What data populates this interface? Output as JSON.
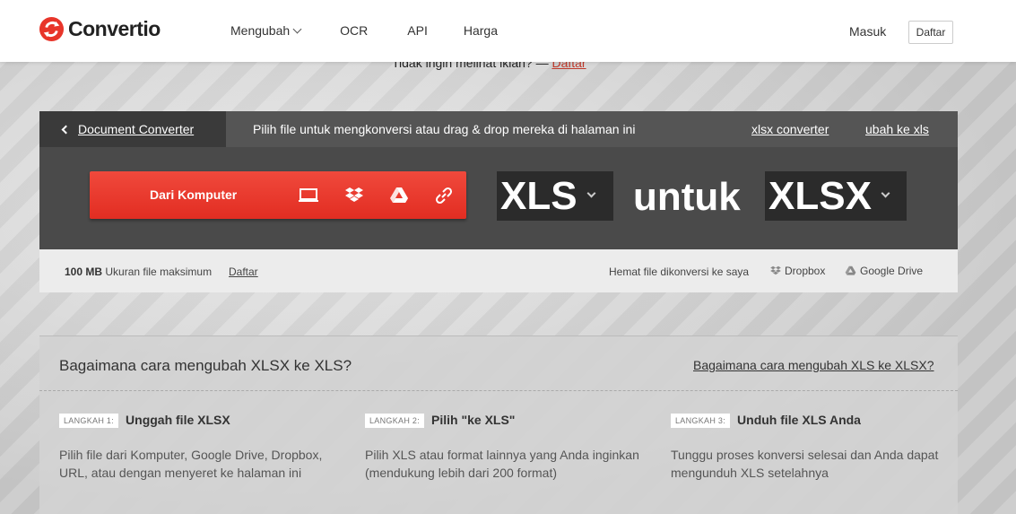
{
  "header": {
    "logo_text": "Convertio",
    "nav": [
      "Mengubah",
      "OCR",
      "API",
      "Harga"
    ],
    "login": "Masuk",
    "signup": "Daftar"
  },
  "ad": {
    "text": "Tidak ingin melihat iklan? —",
    "link": "Daftar"
  },
  "converter": {
    "back_label": "Document Converter",
    "hint": "Pilih file untuk mengkonversi atau drag & drop mereka di halaman ini",
    "link1": "xlsx converter",
    "link2": "ubah ke xls",
    "upload_label": "Dari Komputer",
    "from_format": "XLS",
    "to_word": "untuk",
    "to_format": "XLSX"
  },
  "info": {
    "size_bold": "100 MB",
    "size_text": "Ukuran file maksimum",
    "signup": "Daftar",
    "save_text": "Hemat file dikonversi ke saya",
    "dropbox": "Dropbox",
    "gdrive": "Google Drive"
  },
  "howto": {
    "title": "Bagaimana cara mengubah XLSX ke XLS?",
    "link": "Bagaimana cara mengubah XLS ke XLSX?",
    "steps": [
      {
        "badge": "LANGKAH 1:",
        "title": "Unggah file XLSX",
        "desc": "Pilih file dari Komputer, Google Drive, Dropbox, URL, atau dengan menyeret ke halaman ini"
      },
      {
        "badge": "LANGKAH 2:",
        "title": "Pilih \"ke XLS\"",
        "desc": "Pilih XLS atau format lainnya yang Anda inginkan (mendukung lebih dari 200 format)"
      },
      {
        "badge": "LANGKAH 3:",
        "title": "Unduh file XLS Anda",
        "desc": "Tunggu proses konversi selesai dan Anda dapat mengunduh XLS setelahnya"
      }
    ]
  },
  "colors": {
    "brand": "#e8352a",
    "dark": "#4a4a4a",
    "darker": "#2b2b2b"
  }
}
